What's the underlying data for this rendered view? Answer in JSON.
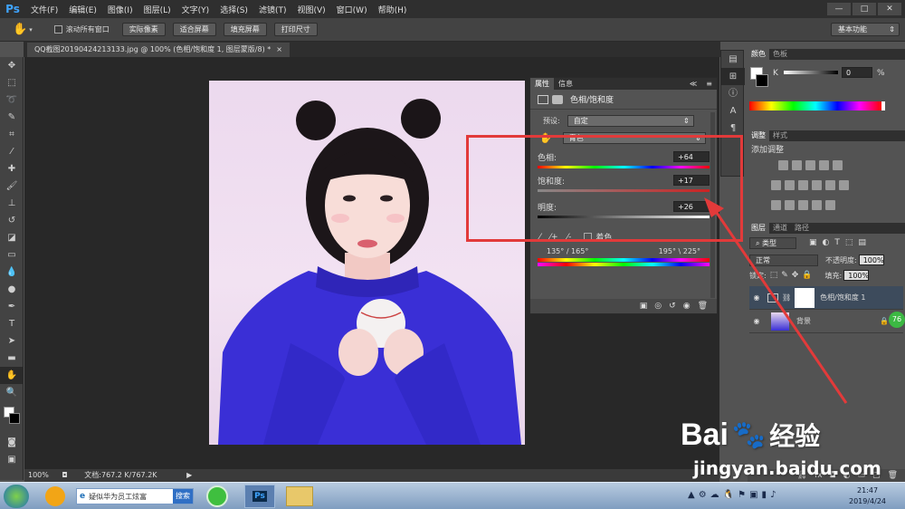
{
  "app": {
    "logo": "Ps"
  },
  "menu": [
    "文件(F)",
    "编辑(E)",
    "图像(I)",
    "图层(L)",
    "文字(Y)",
    "选择(S)",
    "滤镜(T)",
    "视图(V)",
    "窗口(W)",
    "帮助(H)"
  ],
  "window_controls": [
    "—",
    "□",
    "✕"
  ],
  "options": {
    "checkbox_label": "滚动所有窗口",
    "buttons": [
      "实际像素",
      "适合屏幕",
      "填充屏幕",
      "打印尺寸"
    ],
    "workspace": "基本功能"
  },
  "document": {
    "tab_title": "QQ截图20190424213133.jpg @ 100% (色相/饱和度 1, 图层蒙版/8) *",
    "zoom": "100%",
    "doc_size": "文档:767.2 K/767.2K"
  },
  "properties_panel": {
    "tabs": [
      "属性",
      "信息"
    ],
    "title": "色相/饱和度",
    "preset_label": "预设:",
    "preset_value": "自定",
    "channel_value": "青色",
    "hue_label": "色相:",
    "hue_value": "+64",
    "saturation_label": "饱和度:",
    "saturation_value": "+17",
    "lightness_label": "明度:",
    "lightness_value": "+26",
    "colorize_label": "着色",
    "range_left": "135° / 165°",
    "range_right": "195° \\ 225°"
  },
  "color_panel": {
    "tabs": [
      "颜色",
      "色板"
    ],
    "channel": "K",
    "value": "0",
    "unit": "%"
  },
  "adjustments_panel": {
    "tabs": [
      "调整",
      "样式"
    ],
    "title": "添加调整"
  },
  "layers_panel": {
    "tabs": [
      "图层",
      "通道",
      "路径"
    ],
    "filter_label": "类型",
    "blend_mode": "正常",
    "opacity_label": "不透明度:",
    "opacity_value": "100%",
    "lock_label": "锁定:",
    "fill_label": "填充:",
    "fill_value": "100%",
    "layers": [
      {
        "name": "色相/饱和度 1"
      },
      {
        "name": "背景"
      }
    ],
    "badge": "76"
  },
  "taskbar": {
    "search_text": "疑似华为员工炫富",
    "search_button": "搜索",
    "time": "21:47",
    "date": "2019/4/24"
  },
  "watermark": {
    "brand": "Bai",
    "brand_suffix": "经验",
    "url": "jingyan.baidu.com"
  }
}
